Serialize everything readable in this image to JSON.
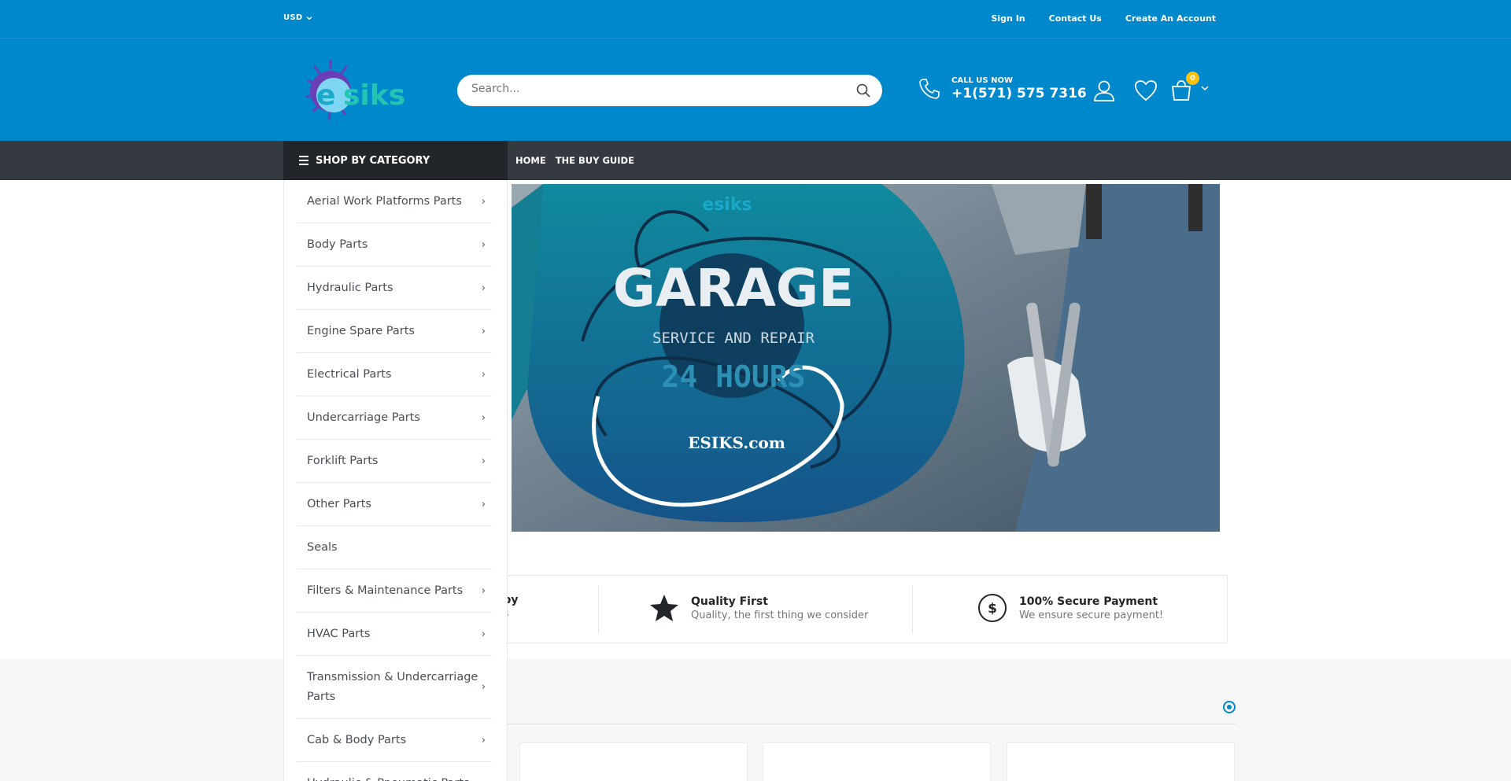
{
  "topbar": {
    "currency": "USD",
    "links": [
      "Sign In",
      "Contact Us",
      "Create An Account"
    ]
  },
  "header": {
    "logo_text": "esiks",
    "search_placeholder": "Search...",
    "call_label": "CALL US NOW",
    "phone": "+1(571) 575 7316",
    "cart_count": "0"
  },
  "nav": {
    "shop_by_category": "SHOP BY CATEGORY",
    "links": [
      "HOME",
      "THE BUY GUIDE"
    ]
  },
  "categories": [
    {
      "label": "Aerial Work Platforms Parts",
      "has_submenu": true
    },
    {
      "label": "Body Parts",
      "has_submenu": true
    },
    {
      "label": "Hydraulic Parts",
      "has_submenu": true
    },
    {
      "label": "Engine Spare Parts",
      "has_submenu": true
    },
    {
      "label": "Electrical Parts",
      "has_submenu": true
    },
    {
      "label": "Undercarriage Parts",
      "has_submenu": true
    },
    {
      "label": "Forklift Parts",
      "has_submenu": true
    },
    {
      "label": "Other Parts",
      "has_submenu": true
    },
    {
      "label": "Seals",
      "has_submenu": false
    },
    {
      "label": "Filters & Maintenance Parts",
      "has_submenu": true
    },
    {
      "label": "HVAC Parts",
      "has_submenu": true
    },
    {
      "label": "Transmission & Undercarriage Parts",
      "has_submenu": true
    },
    {
      "label": "Cab & Body Parts",
      "has_submenu": true
    },
    {
      "label": "Hydraulic & Pneumatic Parts",
      "has_submenu": true
    }
  ],
  "banner": {
    "brand": "esiks",
    "title": "GARAGE",
    "subtitle": "SERVICE AND REPAIR",
    "hours": "24 HOURS",
    "site": "ESIKS.com"
  },
  "info": {
    "partial_title": "e by",
    "partial_sub": "ess",
    "quality_title": "Quality First",
    "quality_sub": "Quality, the first thing we consider",
    "payment_title": "100% Secure Payment",
    "payment_sub": "We ensure secure payment!"
  },
  "colors": {
    "primary": "#0088cc",
    "dark_nav": "#343a40",
    "category_header": "#222529",
    "badge": "#ffc107"
  }
}
